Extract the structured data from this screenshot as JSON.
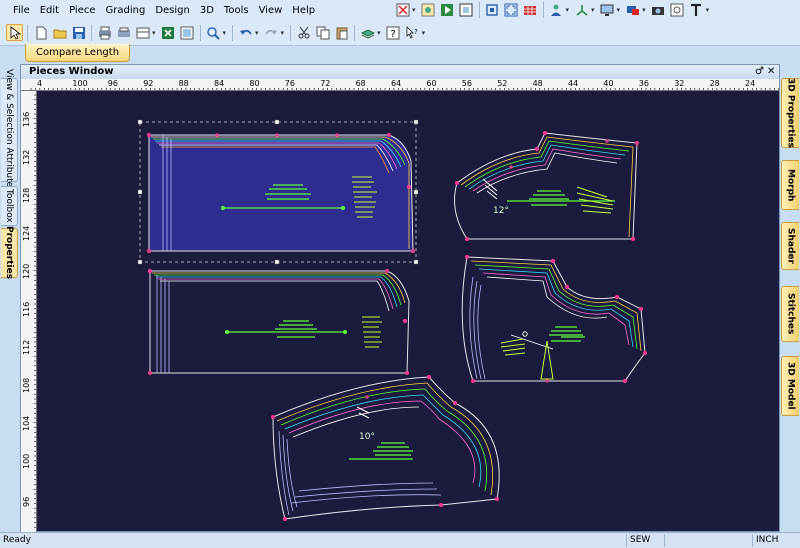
{
  "menu": [
    "File",
    "Edit",
    "Piece",
    "Grading",
    "Design",
    "3D",
    "Tools",
    "View",
    "Help"
  ],
  "compare_tab": "Compare Length",
  "pieces_window": {
    "title": "Pieces Window",
    "pin": "♂",
    "close": "✕"
  },
  "ruler_top": [
    "4",
    "100",
    "96",
    "92",
    "88",
    "84",
    "80",
    "76",
    "72",
    "68",
    "64",
    "60",
    "56",
    "52",
    "48",
    "44",
    "40",
    "36",
    "32",
    "28",
    "24"
  ],
  "ruler_left": [
    "136",
    "132",
    "128",
    "124",
    "120",
    "116",
    "112",
    "108",
    "104",
    "100",
    "96"
  ],
  "left_tabs": [
    "View & Selection Attributes",
    "Toolbox",
    "Properties"
  ],
  "right_tabs": [
    "3D Properties",
    "Morph",
    "Shader",
    "Stitches",
    "3D Model"
  ],
  "status": {
    "ready": "Ready",
    "mode": "SEW",
    "unit": "INCH"
  },
  "piece_labels": {
    "angle1": "12°",
    "angle2": "10°"
  },
  "colors": {
    "canvas_bg": "#1b1b3d",
    "selected_fill": "#2e2d8f",
    "accent_tab": "#f6d77a",
    "point_marker": "#ff3a8c",
    "grainline": "#5cff3a"
  }
}
